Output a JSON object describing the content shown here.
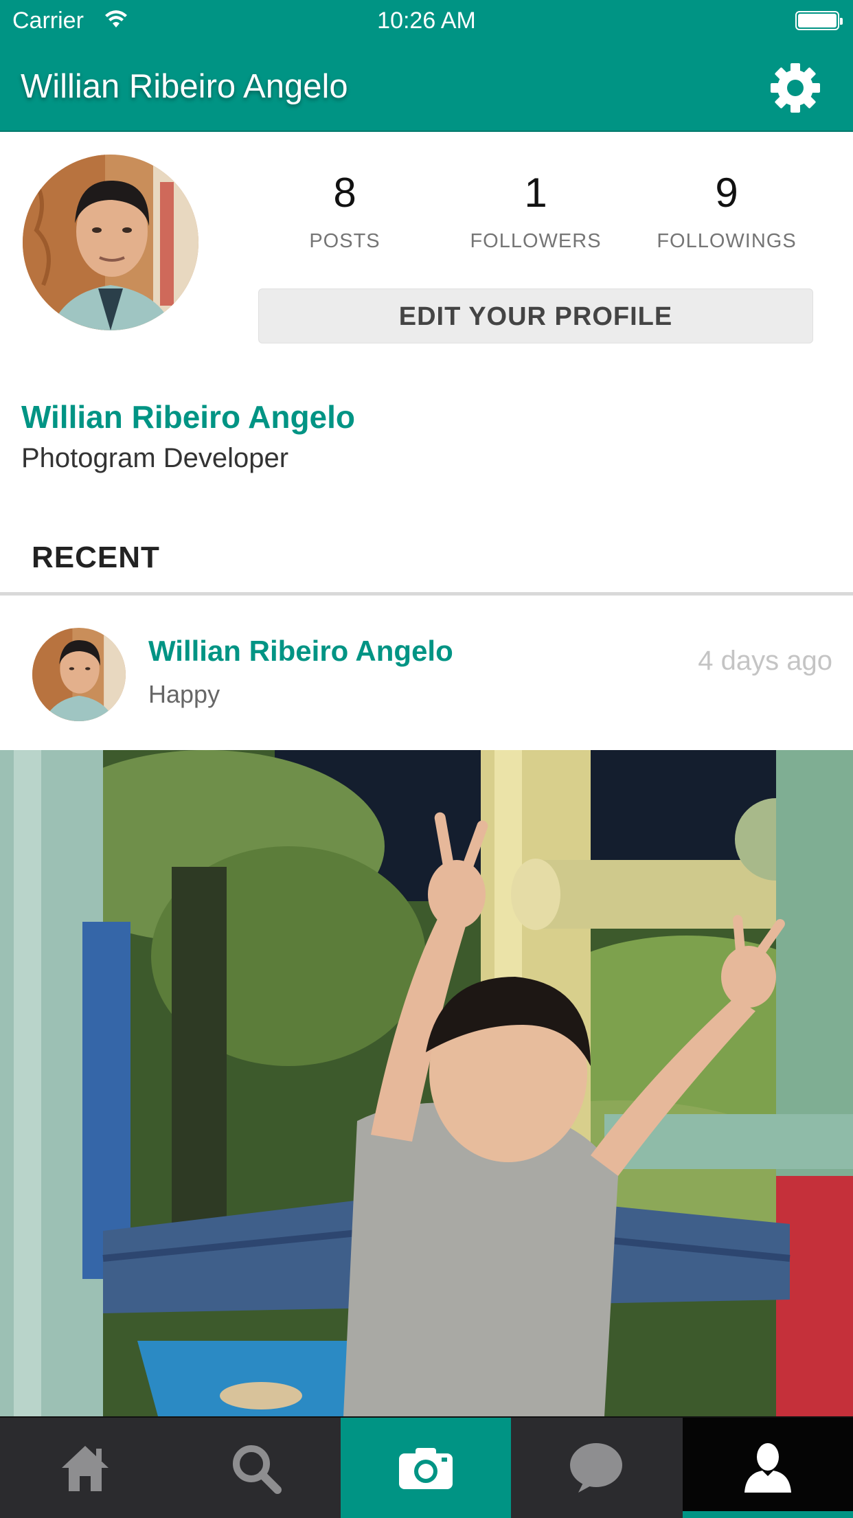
{
  "status_bar": {
    "carrier": "Carrier",
    "time": "10:26 AM"
  },
  "nav": {
    "title": "Willian Ribeiro Angelo",
    "settings_icon": "gear-icon"
  },
  "stats": [
    {
      "value": "8",
      "label": "POSTS"
    },
    {
      "value": "1",
      "label": "FOLLOWERS"
    },
    {
      "value": "9",
      "label": "FOLLOWINGS"
    }
  ],
  "edit_button": "EDIT YOUR PROFILE",
  "profile": {
    "name": "Willian Ribeiro Angelo",
    "bio": "Photogram Developer"
  },
  "section_title": "RECENT",
  "post": {
    "user": "Willian Ribeiro Angelo",
    "caption": "Happy",
    "time": "4 days ago"
  },
  "tabs": [
    {
      "name": "home",
      "icon": "home-icon"
    },
    {
      "name": "search",
      "icon": "search-icon"
    },
    {
      "name": "camera",
      "icon": "camera-icon",
      "active_color": "#009484"
    },
    {
      "name": "chat",
      "icon": "chat-bubble-icon"
    },
    {
      "name": "profile",
      "icon": "user-icon",
      "selected": true
    }
  ],
  "colors": {
    "accent": "#009484",
    "tabbar": "#2b2b2e"
  }
}
